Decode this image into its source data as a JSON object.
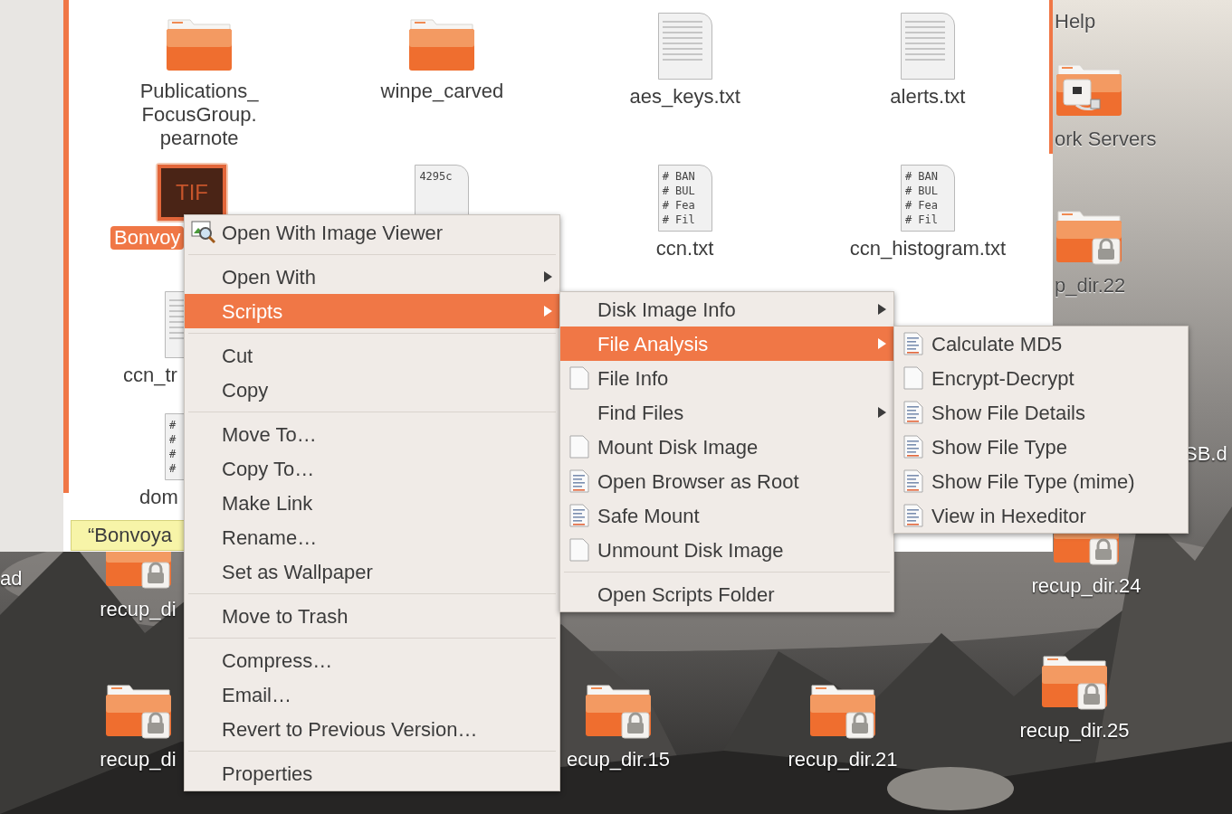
{
  "desktop": {
    "icons": [
      {
        "label": "Help",
        "kind": "label-only"
      },
      {
        "label": "ork Servers",
        "kind": "network-folder"
      },
      {
        "label": "p_dir.22",
        "kind": "locked-folder"
      },
      {
        "label": "SB.d",
        "kind": "label-only"
      },
      {
        "label": "ad",
        "kind": "label-only"
      },
      {
        "label": "recup_di",
        "kind": "locked-folder"
      },
      {
        "label": "recup_dir.24",
        "kind": "locked-folder"
      },
      {
        "label": "recup_di",
        "kind": "locked-folder"
      },
      {
        "label": "ecup_dir.15",
        "kind": "locked-folder"
      },
      {
        "label": "recup_dir.21",
        "kind": "locked-folder"
      },
      {
        "label": "recup_dir.25",
        "kind": "locked-folder"
      }
    ]
  },
  "window": {
    "files": [
      {
        "label": "Publications_\nFocusGroup.\npearnote",
        "kind": "folder",
        "selected": false
      },
      {
        "label": "winpe_carved",
        "kind": "folder",
        "selected": false
      },
      {
        "label": "aes_keys.txt",
        "kind": "text",
        "selected": false
      },
      {
        "label": "alerts.txt",
        "kind": "text",
        "selected": false
      },
      {
        "label": "Bonvoy",
        "kind": "tiff",
        "preview": [
          "TIF"
        ],
        "selected": true
      },
      {
        "kind": "code",
        "preview": [
          "4295c"
        ],
        "selected": false
      },
      {
        "label": "ccn.txt",
        "kind": "code",
        "preview": [
          "# BAN",
          "# BUL",
          "# Fea",
          "# Fil"
        ],
        "selected": false
      },
      {
        "label": "ccn_histogram.txt",
        "kind": "code",
        "preview": [
          "# BAN",
          "# BUL",
          "# Fea",
          "# Fil"
        ],
        "selected": false
      },
      {
        "label": "ccn_tr",
        "kind": "text",
        "selected": false
      },
      {
        "label": "dom",
        "kind": "code",
        "preview": [
          "#",
          "#",
          "#",
          "#"
        ],
        "selected": false
      }
    ],
    "tooltip": "“Bonvoya"
  },
  "menus": [
    {
      "items": [
        {
          "label": "Open With Image Viewer",
          "kind": "viewer",
          "selected": false
        },
        {
          "kind": "separator"
        },
        {
          "label": "Open With",
          "kind": "submenu",
          "selected": false
        },
        {
          "label": "Scripts",
          "kind": "submenu",
          "selected": true
        },
        {
          "kind": "separator"
        },
        {
          "label": "Cut",
          "kind": "plain",
          "selected": false
        },
        {
          "label": "Copy",
          "kind": "plain",
          "selected": false
        },
        {
          "kind": "separator"
        },
        {
          "label": "Move To…",
          "kind": "plain",
          "selected": false
        },
        {
          "label": "Copy To…",
          "kind": "plain",
          "selected": false
        },
        {
          "label": "Make Link",
          "kind": "plain",
          "selected": false
        },
        {
          "label": "Rename…",
          "kind": "plain",
          "selected": false
        },
        {
          "label": "Set as Wallpaper",
          "kind": "plain",
          "selected": false
        },
        {
          "kind": "separator"
        },
        {
          "label": "Move to Trash",
          "kind": "plain",
          "selected": false
        },
        {
          "kind": "separator"
        },
        {
          "label": "Compress…",
          "kind": "plain",
          "selected": false
        },
        {
          "label": "Email…",
          "kind": "plain",
          "selected": false
        },
        {
          "label": "Revert to Previous Version…",
          "kind": "plain",
          "selected": false
        },
        {
          "kind": "separator"
        },
        {
          "label": "Properties",
          "kind": "plain",
          "selected": false
        }
      ]
    },
    {
      "items": [
        {
          "label": "Disk Image Info",
          "kind": "submenu",
          "selected": false
        },
        {
          "label": "File Analysis",
          "kind": "submenu",
          "selected": true
        },
        {
          "label": "File Info",
          "kind": "file",
          "selected": false
        },
        {
          "label": "Find Files",
          "kind": "submenu",
          "selected": false
        },
        {
          "label": "Mount Disk Image",
          "kind": "file",
          "selected": false
        },
        {
          "label": "Open Browser as Root",
          "kind": "script",
          "selected": false
        },
        {
          "label": "Safe Mount",
          "kind": "script",
          "selected": false
        },
        {
          "label": "Unmount Disk Image",
          "kind": "file",
          "selected": false
        },
        {
          "kind": "separator"
        },
        {
          "label": "Open Scripts Folder",
          "kind": "plain",
          "selected": false
        }
      ]
    },
    {
      "items": [
        {
          "label": "Calculate MD5",
          "kind": "script",
          "selected": false
        },
        {
          "label": "Encrypt-Decrypt",
          "kind": "file",
          "selected": false
        },
        {
          "label": "Show File Details",
          "kind": "script",
          "selected": false
        },
        {
          "label": "Show File Type",
          "kind": "script",
          "selected": false
        },
        {
          "label": "Show File Type (mime)",
          "kind": "script",
          "selected": false
        },
        {
          "label": "View in Hexeditor",
          "kind": "script",
          "selected": false
        }
      ]
    }
  ]
}
